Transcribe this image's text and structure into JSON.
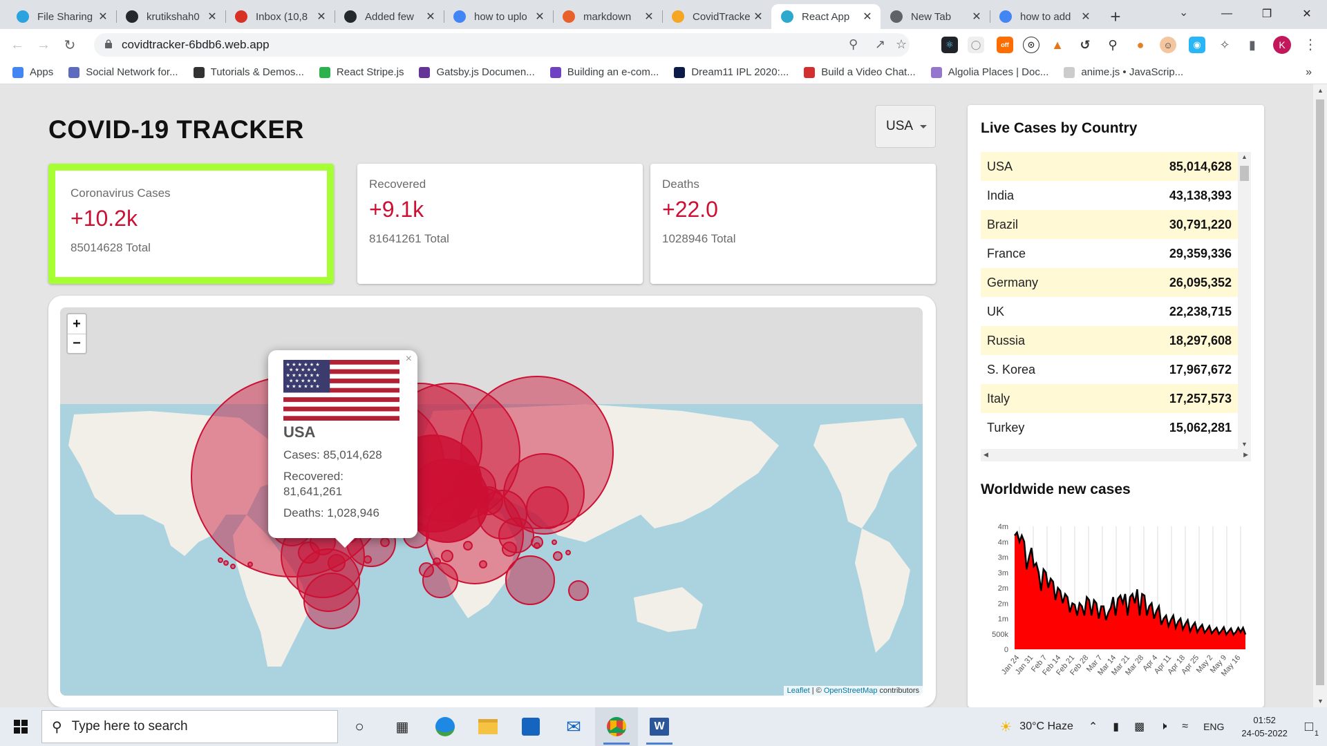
{
  "browser": {
    "tabs": [
      {
        "title": "File Sharing",
        "icon": "telegram-icon",
        "color": "#2aa3de"
      },
      {
        "title": "krutikshah0",
        "icon": "github-icon",
        "color": "#24292e"
      },
      {
        "title": "Inbox (10,8",
        "icon": "gmail-icon",
        "color": "#d93025"
      },
      {
        "title": "Added few",
        "icon": "github-icon",
        "color": "#24292e"
      },
      {
        "title": "how to uplo",
        "icon": "google-icon",
        "color": "#4285f4"
      },
      {
        "title": "markdown",
        "icon": "markdown-icon",
        "color": "#e8612c"
      },
      {
        "title": "CovidTracke",
        "icon": "firebase-icon",
        "color": "#f5a623"
      },
      {
        "title": "React App",
        "icon": "react-icon",
        "color": "#2ea8cc",
        "active": true
      },
      {
        "title": "New Tab",
        "icon": "chrome-icon",
        "color": "#5f6368"
      },
      {
        "title": "how to add",
        "icon": "google-icon",
        "color": "#4285f4"
      }
    ],
    "url": "covidtracker-6bdb6.web.app",
    "profile_initial": "K",
    "bookmarks": [
      {
        "label": "Apps",
        "icon": "apps-grid-icon",
        "color": "#4285f4"
      },
      {
        "label": "Social Network for...",
        "icon": "social-network-icon",
        "color": "#5c6bc0"
      },
      {
        "label": "Tutorials & Demos...",
        "icon": "tutorials-icon",
        "color": "#333333"
      },
      {
        "label": "React Stripe.js",
        "icon": "stripe-icon",
        "color": "#2bb24c"
      },
      {
        "label": "Gatsby.js Documen...",
        "icon": "gatsby-icon",
        "color": "#663399"
      },
      {
        "label": "Building an e-com...",
        "icon": "building-icon",
        "color": "#6f42c1"
      },
      {
        "label": "Dream11 IPL 2020:...",
        "icon": "dream11-icon",
        "color": "#0d1b48"
      },
      {
        "label": "Build a Video Chat...",
        "icon": "video-chat-icon",
        "color": "#d32f2f"
      },
      {
        "label": "Algolia Places | Doc...",
        "icon": "algolia-icon",
        "color": "#9575cd"
      },
      {
        "label": "anime.js • JavaScrip...",
        "icon": "anime-js-icon",
        "color": "#cccccc"
      }
    ]
  },
  "app": {
    "title": "COVID-19 TRACKER",
    "selected_country": "USA",
    "stats": [
      {
        "label": "Coronavirus Cases",
        "value": "+10.2k",
        "total": "85014628 Total",
        "selected": true
      },
      {
        "label": "Recovered",
        "value": "+9.1k",
        "total": "81641261 Total",
        "selected": false
      },
      {
        "label": "Deaths",
        "value": "+22.0",
        "total": "1028946 Total",
        "selected": false
      }
    ],
    "map": {
      "zoom_in": "+",
      "zoom_out": "−",
      "attribution_leaflet": "Leaflet",
      "attribution_sep": " | © ",
      "attribution_osm": "OpenStreetMap",
      "attribution_rest": " contributors",
      "popup": {
        "country": "USA",
        "cases": "Cases: 85,014,628",
        "recovered_label": "Recovered:",
        "recovered_value": "81,641,261",
        "deaths": "Deaths: 1,028,946",
        "close": "×"
      }
    },
    "live_cases": {
      "title": "Live Cases by Country",
      "rows": [
        {
          "country": "USA",
          "cases": "85,014,628"
        },
        {
          "country": "India",
          "cases": "43,138,393"
        },
        {
          "country": "Brazil",
          "cases": "30,791,220"
        },
        {
          "country": "France",
          "cases": "29,359,336"
        },
        {
          "country": "Germany",
          "cases": "26,095,352"
        },
        {
          "country": "UK",
          "cases": "22,238,715"
        },
        {
          "country": "Russia",
          "cases": "18,297,608"
        },
        {
          "country": "S. Korea",
          "cases": "17,967,672"
        },
        {
          "country": "Italy",
          "cases": "17,257,573"
        },
        {
          "country": "Turkey",
          "cases": "15,062,281"
        }
      ]
    },
    "chart_title": "Worldwide new cases"
  },
  "chart_data": {
    "type": "area",
    "title": "Worldwide new cases",
    "color": "#ff0000",
    "line_color": "#000000",
    "y_tick_labels": [
      "0",
      "500k",
      "1m",
      "2m",
      "2m",
      "3m",
      "3m",
      "4m",
      "4m"
    ],
    "y_tick_values": [
      0,
      500000,
      1000000,
      1500000,
      2000000,
      2500000,
      3000000,
      3500000,
      4000000
    ],
    "ylim": [
      0,
      4000000
    ],
    "x_tick_labels": [
      "Jan 24",
      "Jan 31",
      "Feb 7",
      "Feb 14",
      "Feb 21",
      "Feb 28",
      "Mar 7",
      "Mar 14",
      "Mar 21",
      "Mar 28",
      "Apr 4",
      "Apr 11",
      "Apr 18",
      "Apr 25",
      "May 2",
      "May 9",
      "May 16"
    ],
    "values": [
      3700000,
      3800000,
      3500000,
      3700000,
      3500000,
      2600000,
      3000000,
      3300000,
      2700000,
      2800000,
      2500000,
      1900000,
      2600000,
      2500000,
      2000000,
      2300000,
      2200000,
      1600000,
      2000000,
      1900000,
      1500000,
      1800000,
      1700000,
      1200000,
      1500000,
      1450000,
      1100000,
      1500000,
      1400000,
      1100000,
      1700000,
      1600000,
      1100000,
      1600000,
      1500000,
      1000000,
      1400000,
      1400000,
      950000,
      1200000,
      1350000,
      1700000,
      1100000,
      1650000,
      1750000,
      1500000,
      1800000,
      1100000,
      1700000,
      1800000,
      1500000,
      1950000,
      1100000,
      1800000,
      1750000,
      1100000,
      1400000,
      1500000,
      1000000,
      1250000,
      1400000,
      800000,
      1000000,
      1100000,
      750000,
      950000,
      1100000,
      700000,
      900000,
      1000000,
      650000,
      820000,
      950000,
      580000,
      760000,
      870000,
      560000,
      700000,
      800000,
      540000,
      640000,
      760000,
      520000,
      620000,
      700000,
      500000,
      600000,
      720000,
      480000,
      580000,
      680000,
      480000,
      560000,
      700000,
      560000,
      700000,
      480000
    ]
  },
  "taskbar": {
    "search_placeholder": "Type here to search",
    "weather": "30°C  Haze",
    "language": "ENG",
    "time": "01:52",
    "date": "24-05-2022",
    "notification_count": "1"
  }
}
